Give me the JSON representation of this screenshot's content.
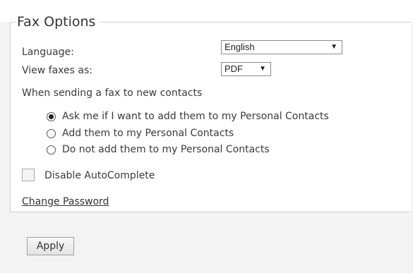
{
  "fax_options": {
    "title": "Fax Options",
    "language_label": "Language:",
    "language_value": "English",
    "view_label": "View faxes as:",
    "view_value": "PDF",
    "contacts_heading": "When sending a fax to new contacts",
    "radio_options": [
      {
        "label": "Ask me if I want to add them to my Personal Contacts",
        "checked": true
      },
      {
        "label": "Add them to my Personal Contacts",
        "checked": false
      },
      {
        "label": "Do not add them to my Personal Contacts",
        "checked": false
      }
    ],
    "autocomplete_label": "Disable AutoComplete",
    "autocomplete_checked": false,
    "change_password": "Change Password"
  },
  "footer": {
    "apply_label": "Apply"
  },
  "icons": {
    "dropdown": "triangle-down-icon"
  }
}
